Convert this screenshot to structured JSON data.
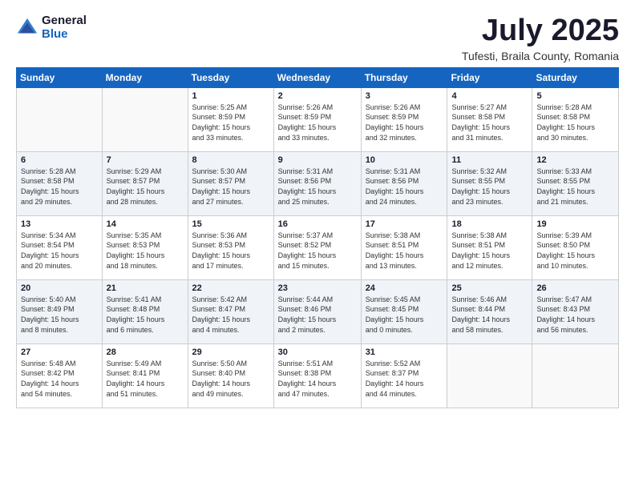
{
  "logo": {
    "general": "General",
    "blue": "Blue"
  },
  "title": "July 2025",
  "location": "Tufesti, Braila County, Romania",
  "weekdays": [
    "Sunday",
    "Monday",
    "Tuesday",
    "Wednesday",
    "Thursday",
    "Friday",
    "Saturday"
  ],
  "weeks": [
    [
      {
        "day": "",
        "detail": ""
      },
      {
        "day": "",
        "detail": ""
      },
      {
        "day": "1",
        "detail": "Sunrise: 5:25 AM\nSunset: 8:59 PM\nDaylight: 15 hours\nand 33 minutes."
      },
      {
        "day": "2",
        "detail": "Sunrise: 5:26 AM\nSunset: 8:59 PM\nDaylight: 15 hours\nand 33 minutes."
      },
      {
        "day": "3",
        "detail": "Sunrise: 5:26 AM\nSunset: 8:59 PM\nDaylight: 15 hours\nand 32 minutes."
      },
      {
        "day": "4",
        "detail": "Sunrise: 5:27 AM\nSunset: 8:58 PM\nDaylight: 15 hours\nand 31 minutes."
      },
      {
        "day": "5",
        "detail": "Sunrise: 5:28 AM\nSunset: 8:58 PM\nDaylight: 15 hours\nand 30 minutes."
      }
    ],
    [
      {
        "day": "6",
        "detail": "Sunrise: 5:28 AM\nSunset: 8:58 PM\nDaylight: 15 hours\nand 29 minutes."
      },
      {
        "day": "7",
        "detail": "Sunrise: 5:29 AM\nSunset: 8:57 PM\nDaylight: 15 hours\nand 28 minutes."
      },
      {
        "day": "8",
        "detail": "Sunrise: 5:30 AM\nSunset: 8:57 PM\nDaylight: 15 hours\nand 27 minutes."
      },
      {
        "day": "9",
        "detail": "Sunrise: 5:31 AM\nSunset: 8:56 PM\nDaylight: 15 hours\nand 25 minutes."
      },
      {
        "day": "10",
        "detail": "Sunrise: 5:31 AM\nSunset: 8:56 PM\nDaylight: 15 hours\nand 24 minutes."
      },
      {
        "day": "11",
        "detail": "Sunrise: 5:32 AM\nSunset: 8:55 PM\nDaylight: 15 hours\nand 23 minutes."
      },
      {
        "day": "12",
        "detail": "Sunrise: 5:33 AM\nSunset: 8:55 PM\nDaylight: 15 hours\nand 21 minutes."
      }
    ],
    [
      {
        "day": "13",
        "detail": "Sunrise: 5:34 AM\nSunset: 8:54 PM\nDaylight: 15 hours\nand 20 minutes."
      },
      {
        "day": "14",
        "detail": "Sunrise: 5:35 AM\nSunset: 8:53 PM\nDaylight: 15 hours\nand 18 minutes."
      },
      {
        "day": "15",
        "detail": "Sunrise: 5:36 AM\nSunset: 8:53 PM\nDaylight: 15 hours\nand 17 minutes."
      },
      {
        "day": "16",
        "detail": "Sunrise: 5:37 AM\nSunset: 8:52 PM\nDaylight: 15 hours\nand 15 minutes."
      },
      {
        "day": "17",
        "detail": "Sunrise: 5:38 AM\nSunset: 8:51 PM\nDaylight: 15 hours\nand 13 minutes."
      },
      {
        "day": "18",
        "detail": "Sunrise: 5:38 AM\nSunset: 8:51 PM\nDaylight: 15 hours\nand 12 minutes."
      },
      {
        "day": "19",
        "detail": "Sunrise: 5:39 AM\nSunset: 8:50 PM\nDaylight: 15 hours\nand 10 minutes."
      }
    ],
    [
      {
        "day": "20",
        "detail": "Sunrise: 5:40 AM\nSunset: 8:49 PM\nDaylight: 15 hours\nand 8 minutes."
      },
      {
        "day": "21",
        "detail": "Sunrise: 5:41 AM\nSunset: 8:48 PM\nDaylight: 15 hours\nand 6 minutes."
      },
      {
        "day": "22",
        "detail": "Sunrise: 5:42 AM\nSunset: 8:47 PM\nDaylight: 15 hours\nand 4 minutes."
      },
      {
        "day": "23",
        "detail": "Sunrise: 5:44 AM\nSunset: 8:46 PM\nDaylight: 15 hours\nand 2 minutes."
      },
      {
        "day": "24",
        "detail": "Sunrise: 5:45 AM\nSunset: 8:45 PM\nDaylight: 15 hours\nand 0 minutes."
      },
      {
        "day": "25",
        "detail": "Sunrise: 5:46 AM\nSunset: 8:44 PM\nDaylight: 14 hours\nand 58 minutes."
      },
      {
        "day": "26",
        "detail": "Sunrise: 5:47 AM\nSunset: 8:43 PM\nDaylight: 14 hours\nand 56 minutes."
      }
    ],
    [
      {
        "day": "27",
        "detail": "Sunrise: 5:48 AM\nSunset: 8:42 PM\nDaylight: 14 hours\nand 54 minutes."
      },
      {
        "day": "28",
        "detail": "Sunrise: 5:49 AM\nSunset: 8:41 PM\nDaylight: 14 hours\nand 51 minutes."
      },
      {
        "day": "29",
        "detail": "Sunrise: 5:50 AM\nSunset: 8:40 PM\nDaylight: 14 hours\nand 49 minutes."
      },
      {
        "day": "30",
        "detail": "Sunrise: 5:51 AM\nSunset: 8:38 PM\nDaylight: 14 hours\nand 47 minutes."
      },
      {
        "day": "31",
        "detail": "Sunrise: 5:52 AM\nSunset: 8:37 PM\nDaylight: 14 hours\nand 44 minutes."
      },
      {
        "day": "",
        "detail": ""
      },
      {
        "day": "",
        "detail": ""
      }
    ]
  ]
}
